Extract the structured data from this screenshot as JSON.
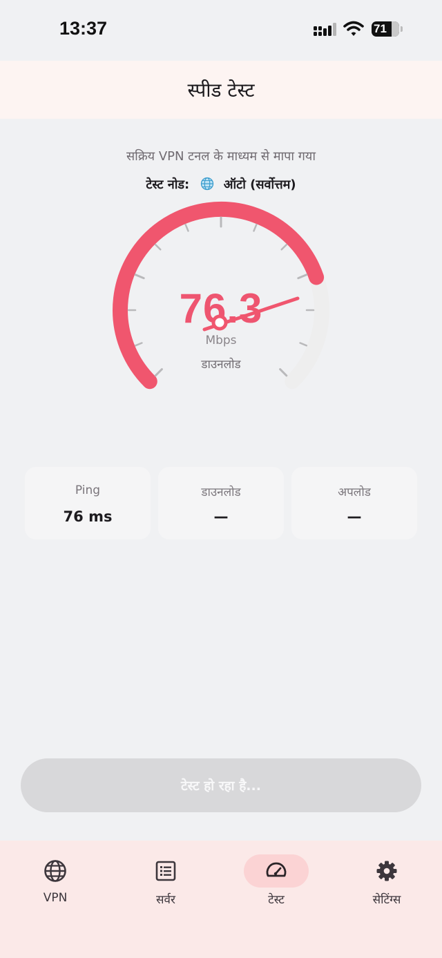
{
  "status_bar": {
    "time": "13:37",
    "battery": "71"
  },
  "header": {
    "title": "स्पीड टेस्ट"
  },
  "info": {
    "subtitle": "सक्रिय VPN टनल के माध्यम से मापा गया",
    "node_label": "टेस्ट नोड:",
    "node_value": "ऑटो (सर्वोत्तम)"
  },
  "gauge": {
    "value": "76.3",
    "unit": "Mbps",
    "mode": "डाउनलोड",
    "fraction": 0.763,
    "accent": "#f0566e",
    "track": "#eeeeee"
  },
  "stats": [
    {
      "label": "Ping",
      "value": "76 ms"
    },
    {
      "label": "डाउनलोड",
      "value": "—"
    },
    {
      "label": "अपलोड",
      "value": "—"
    }
  ],
  "action": {
    "label": "टेस्ट हो रहा है..."
  },
  "nav": {
    "items": [
      {
        "label": "VPN",
        "icon": "globe-icon"
      },
      {
        "label": "सर्वर",
        "icon": "list-icon"
      },
      {
        "label": "टेस्ट",
        "icon": "speedometer-icon"
      },
      {
        "label": "सेटिंग्स",
        "icon": "gear-icon"
      }
    ],
    "active_index": 2
  }
}
